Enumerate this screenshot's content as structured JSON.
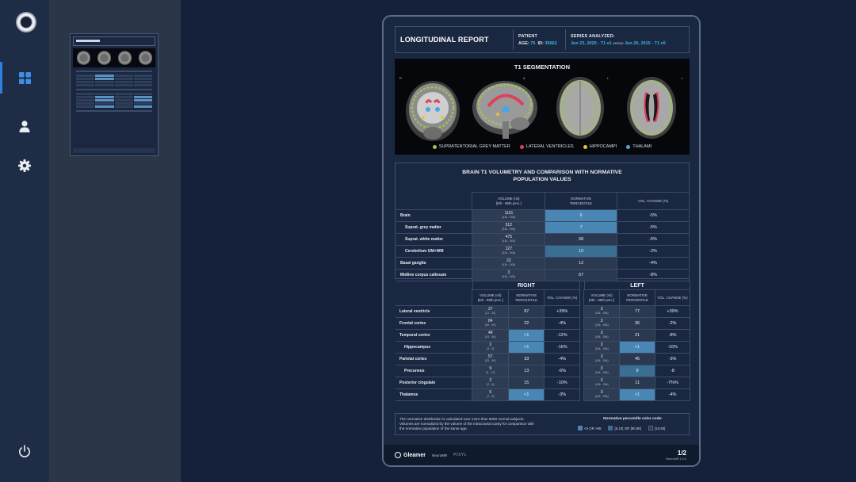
{
  "nav": {
    "items": [
      {
        "name": "dashboard",
        "icon": "grid-icon",
        "active": true
      },
      {
        "name": "user",
        "icon": "user-icon"
      },
      {
        "name": "settings",
        "icon": "gear-icon"
      },
      {
        "name": "power",
        "icon": "power-icon"
      }
    ]
  },
  "colors": {
    "background": "#15213a",
    "rail": "#1e2c46",
    "accent": "#2d7fe0",
    "highlight": "#4a86b4",
    "cyan": "#3db8e8"
  },
  "report": {
    "title": "LONGITUDINAL REPORT",
    "patient_label": "PATIENT",
    "age_label": "AGE:",
    "age": "75",
    "id_label": "ID:",
    "id": "35662",
    "series_label": "SERIES ANALYZED:",
    "series_current": "Jun 23, 2020 - T1 v1",
    "versus": "versus",
    "series_prior": "Jun 26, 2015 - T1 v0"
  },
  "segmentation": {
    "title": "T1 SEGMENTATION",
    "orientations": [
      "R",
      "A",
      "L",
      "L"
    ],
    "legend": [
      {
        "label": "SUPRATENTORIAL GREY MATTER",
        "color": "#9dc35a"
      },
      {
        "label": "LATERAL VENTRICLES",
        "color": "#e0405a"
      },
      {
        "label": "HIPPOCAMPI",
        "color": "#e8c23a"
      },
      {
        "label": "THALAMI",
        "color": "#4aa8e0"
      }
    ]
  },
  "volumetry": {
    "title_line1": "BRAIN T1 VOLUMETRY AND COMPARISON WITH NORMATIVE",
    "title_line2": "POPULATION VALUES",
    "headers": {
      "volume": "VOLUME (ml)",
      "volume_sub": "[5th - 95th perc.]",
      "percentile": "NORMATIVE",
      "percentile_sub": "PERCENTILE",
      "change": "VOL. CHANGE (%)"
    },
    "rows": [
      {
        "label": "Brain",
        "sub": false,
        "volume": "1115",
        "range": "[43k - 50k]",
        "percentile": "6",
        "pct_hl": "hl",
        "change": "-5%"
      },
      {
        "label": "Suprat. grey matter",
        "sub": true,
        "volume": "512",
        "range": "[43k - 50k]",
        "percentile": "7",
        "pct_hl": "hl",
        "change": "-5%"
      },
      {
        "label": "Suprat. white matter",
        "sub": true,
        "volume": "475",
        "range": "[43k - 50k]",
        "percentile": "58",
        "pct_hl": "",
        "change": "-5%"
      },
      {
        "label": "Cerebellum GM+WM",
        "sub": true,
        "volume": "127",
        "range": "[43k - 50k]",
        "percentile": "10",
        "pct_hl": "hl2",
        "change": "-2%"
      },
      {
        "label": "Basal ganglia",
        "sub": false,
        "volume": "23",
        "range": "[43k - 50k]",
        "percentile": "12",
        "pct_hl": "",
        "change": "-4%"
      },
      {
        "label": "Midline corpus callosum",
        "sub": false,
        "volume": "3",
        "range": "[43k - 50k]",
        "percentile": "67",
        "pct_hl": "",
        "change": "-8%"
      }
    ]
  },
  "hemispheres": {
    "right_title": "RIGHT",
    "left_title": "LEFT",
    "headers": {
      "volume": "VOLUME (ml)",
      "volume_sub": "[5th - 95th perc.]",
      "percentile": "NORMATIVE",
      "percentile_sub": "PERCENTILE",
      "change": "VOL. CHANGE (%)"
    },
    "rows": [
      {
        "label": "Lateral ventricle",
        "sub": false,
        "r_vol": "27",
        "r_range": "[11 - 30]",
        "r_pct": "87",
        "r_hl": "",
        "r_chg": "+39%",
        "l_vol": "3",
        "l_range": "[43k - 50k]",
        "l_pct": "77",
        "l_hl": "",
        "l_chg": "+39%"
      },
      {
        "label": "Frontal cortex",
        "sub": false,
        "r_vol": "84",
        "r_range": "[50 - 90]",
        "r_pct": "22",
        "r_hl": "",
        "r_chg": "-4%",
        "l_vol": "3",
        "l_range": "[43k - 50k]",
        "l_pct": "36",
        "l_hl": "",
        "l_chg": "-2%"
      },
      {
        "label": "Temporal cortex",
        "sub": false,
        "r_vol": "49",
        "r_range": "[43 - 50]",
        "r_pct": "<1",
        "r_hl": "hl",
        "r_chg": "-12%",
        "l_vol": "3",
        "l_range": "[43k - 50k]",
        "l_pct": "21",
        "l_hl": "",
        "l_chg": "-8%"
      },
      {
        "label": "Hippocampus",
        "sub": true,
        "r_vol": "2",
        "r_range": "[3 - 5]",
        "r_pct": "<1",
        "r_hl": "hl",
        "r_chg": "-16%",
        "l_vol": "3",
        "l_range": "[43k - 50k]",
        "l_pct": "<1",
        "l_hl": "hl",
        "l_chg": "-16%"
      },
      {
        "label": "Parietal cortex",
        "sub": false,
        "r_vol": "57",
        "r_range": "[53 - 60]",
        "r_pct": "33",
        "r_hl": "",
        "r_chg": "-4%",
        "l_vol": "3",
        "l_range": "[43k - 50k]",
        "l_pct": "45",
        "l_hl": "",
        "l_chg": "-3%"
      },
      {
        "label": "Precuneus",
        "sub": true,
        "r_vol": "9",
        "r_range": "[5 - 12]",
        "r_pct": "13",
        "r_hl": "",
        "r_chg": "-6%",
        "l_vol": "3",
        "l_range": "[43k - 50k]",
        "l_pct": "8",
        "l_hl": "hl2",
        "l_chg": "-8"
      },
      {
        "label": "Posterior cingulate",
        "sub": false,
        "r_vol": "2",
        "r_range": "[2 - 4]",
        "r_pct": "15",
        "r_hl": "",
        "r_chg": "-10%",
        "l_vol": "3",
        "l_range": "[43k - 50k]",
        "l_pct": "11",
        "l_hl": "",
        "l_chg": "-7%%"
      },
      {
        "label": "Thalamus",
        "sub": false,
        "r_vol": "5",
        "r_range": "[7 - 9]",
        "r_pct": "<1",
        "r_hl": "hl",
        "r_chg": "-3%",
        "l_vol": "3",
        "l_range": "[43k - 50k]",
        "l_pct": "<1",
        "l_hl": "hl",
        "l_chg": "-4%"
      }
    ]
  },
  "notes": {
    "line1": "The normative distribution is calculated over more than 5000 normal subjects.",
    "line2": "Volumes are normalized by the volume of the intracranial cavity for comparison with",
    "line3": "the normative population of the same age.",
    "code_title": "Normative percentile color code:",
    "codes": [
      {
        "label": "<5 OR >95",
        "color": "#4a86b4"
      },
      {
        "label": "[5,10[ OR ]90,95]",
        "color": "#3a6e93"
      },
      {
        "label": "[10,90]",
        "color": "#2d3b53"
      }
    ]
  },
  "footer": {
    "brand": "Gleamer",
    "product": "NeuroMR",
    "partner": "PIXYL",
    "page": "1/2",
    "version": "NeuroMR 1.0.0"
  }
}
